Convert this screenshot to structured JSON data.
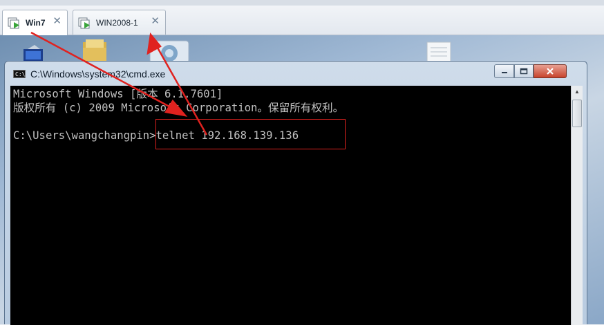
{
  "tabs": [
    {
      "label": "Win7",
      "active": true,
      "close": "✕"
    },
    {
      "label": "WIN2008-1",
      "active": false,
      "close": "✕"
    }
  ],
  "cmd_window": {
    "title": "C:\\Windows\\system32\\cmd.exe",
    "icon_text": "C:\\",
    "lines": [
      "Microsoft Windows [版本 6.1.7601]",
      "版权所有 (c) 2009 Microsoft Corporation。保留所有权利。",
      "",
      "C:\\Users\\wangchangpin>telnet 192.168.139.136"
    ]
  },
  "colors": {
    "annotation": "#e0221f",
    "console_bg": "#000000",
    "console_fg": "#c0c0c0"
  }
}
